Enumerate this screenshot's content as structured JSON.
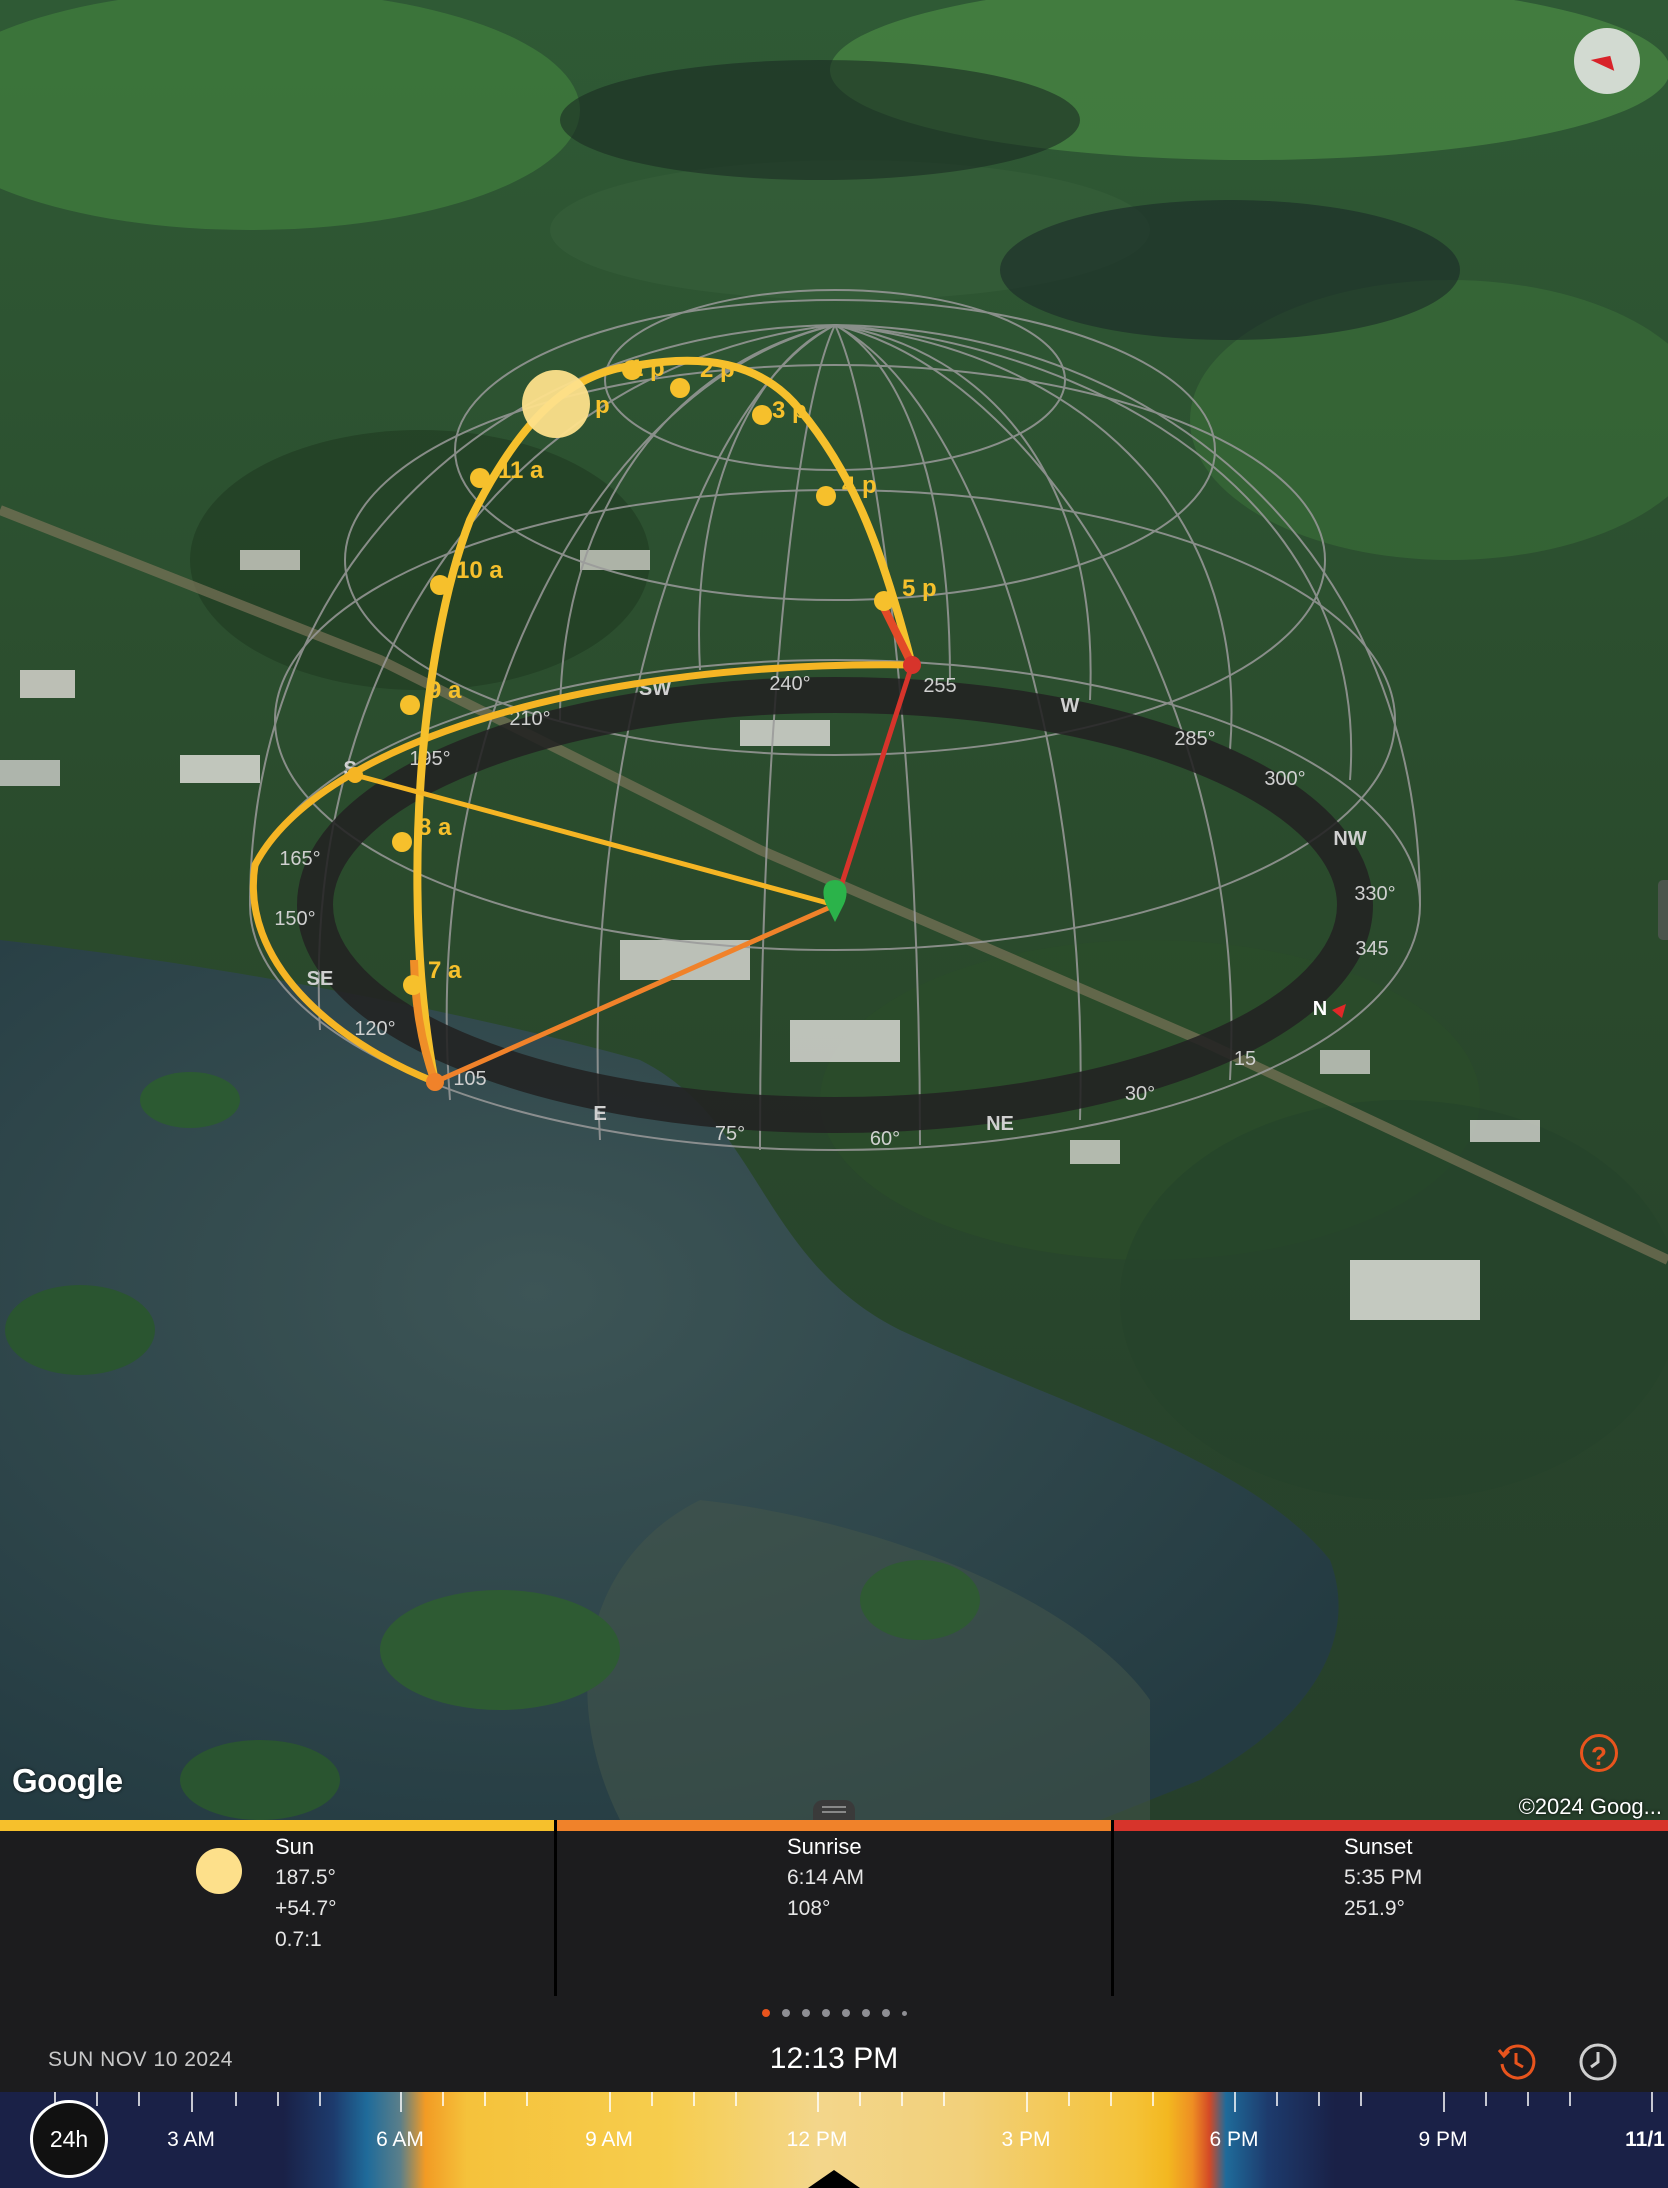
{
  "map": {
    "attribution_logo": "Google",
    "copyright": "©2024 Goog...",
    "help_label": "?"
  },
  "compass_ring": {
    "labels": [
      "240°",
      "255",
      "W",
      "285°",
      "300°",
      "NW",
      "330°",
      "345",
      "N",
      "15",
      "30°",
      "NE",
      "60°",
      "75°",
      "E",
      "105",
      "120°",
      "SE",
      "150°",
      "165°",
      "S",
      "195°",
      "210°",
      "SW"
    ]
  },
  "sun_path": {
    "hour_labels": [
      "7 a",
      "8 a",
      "9 a",
      "10 a",
      "11 a",
      "p",
      "1 p",
      "2 p",
      "3 p",
      "4 p",
      "5 p"
    ]
  },
  "colors": {
    "sun": "#fde08b",
    "sunrise": "#f0822a",
    "sunset": "#d7342b",
    "accent": "#e8541d",
    "path": "#f6c02c"
  },
  "info": {
    "sun": {
      "title": "Sun",
      "azimuth": "187.5°",
      "elevation": "+54.7°",
      "ratio": "0.7:1"
    },
    "sunrise": {
      "title": "Sunrise",
      "time": "6:14 AM",
      "azimuth": "108°"
    },
    "sunset": {
      "title": "Sunset",
      "time": "5:35 PM",
      "azimuth": "251.9°"
    }
  },
  "pager": {
    "count": 8,
    "active_index": 0
  },
  "time_bar": {
    "date": "SUN NOV 10 2024",
    "time": "12:13 PM",
    "history_icon": "history-clock-icon",
    "clock_icon": "clock-icon"
  },
  "timeline": {
    "mode_button": "24h",
    "labels": [
      "3 AM",
      "6 AM",
      "9 AM",
      "12 PM",
      "3 PM",
      "6 PM",
      "9 PM",
      "11/1"
    ]
  }
}
